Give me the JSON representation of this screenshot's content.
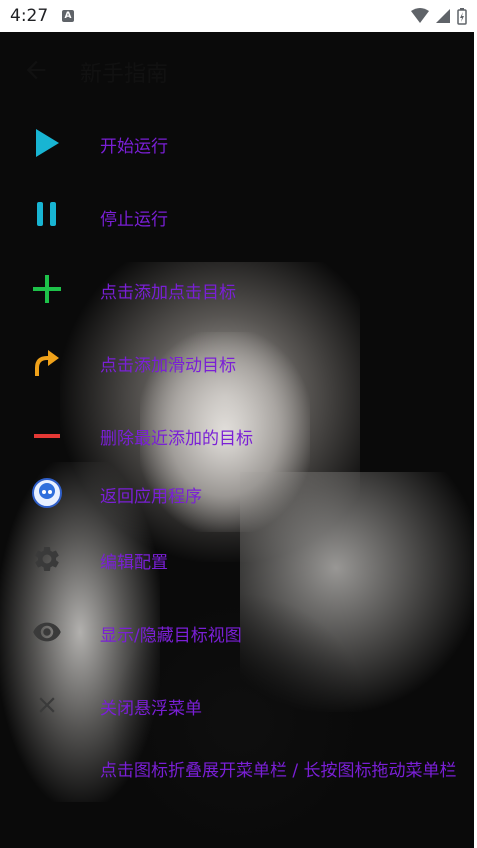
{
  "status": {
    "time": "4:27",
    "indicator": "A"
  },
  "header": {
    "title": "新手指南",
    "back_icon": "arrow-left-icon"
  },
  "colors": {
    "accent_text": "#7a1fd6",
    "play": "#18b5d3",
    "pause": "#18b5d3",
    "add": "#1ec24a",
    "swipe": "#f0a21a",
    "remove": "#e53935",
    "gray_icon": "#3a3a3a"
  },
  "menu": {
    "items": [
      {
        "label": "开始运行",
        "icon": "play-icon"
      },
      {
        "label": "停止运行",
        "icon": "pause-icon"
      },
      {
        "label": "点击添加点击目标",
        "icon": "plus-icon"
      },
      {
        "label": "点击添加滑动目标",
        "icon": "swipe-arrow-icon"
      },
      {
        "label": "删除最近添加的目标",
        "icon": "minus-icon"
      },
      {
        "label": "返回应用程序",
        "icon": "app-avatar-icon"
      },
      {
        "label": "编辑配置",
        "icon": "gear-icon"
      },
      {
        "label": "显示/隐藏目标视图",
        "icon": "eye-icon"
      },
      {
        "label": "关闭悬浮菜单",
        "icon": "close-icon"
      }
    ],
    "footer": "点击图标折叠展开菜单栏 / 长按图标拖动菜单栏"
  }
}
